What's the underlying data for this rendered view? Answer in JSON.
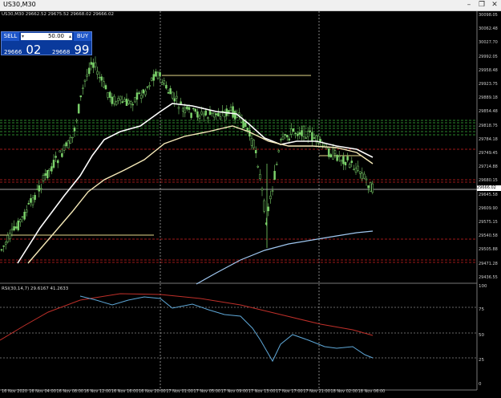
{
  "window": {
    "title": "US30,M30",
    "buttons": [
      "–",
      "❐",
      "✕"
    ]
  },
  "chart_info": {
    "ohlc": "US30,M30 29662.52 29675.52 29668.02 29666.02"
  },
  "trade_panel": {
    "sell_label": "SELL",
    "buy_label": "BUY",
    "lot_value": "50.00",
    "lot_down": "▾",
    "lot_up": "▴",
    "sell_price_prefix": "29666",
    "sell_price_big": "02",
    "buy_price_prefix": "29668",
    "buy_price_big": "99"
  },
  "indicator": {
    "label": "RSI(30,14,7) 29.6167 41.2633",
    "levels": [
      "100",
      "75",
      "50",
      "25",
      "0"
    ]
  },
  "price_axis": [
    "30098.05",
    "30062.48",
    "30027.70",
    "29992.05",
    "29958.48",
    "29923.75",
    "29889.18",
    "29854.48",
    "29818.75",
    "29784.18",
    "29749.45",
    "29714.88",
    "29680.15",
    "29645.58",
    "29609.90",
    "29575.15",
    "29540.58",
    "29505.88",
    "29471.28",
    "29436.55"
  ],
  "current_price_tag": "29666.02",
  "time_axis": [
    "16 Nov 2020",
    "16 Nov 04:00",
    "16 Nov 08:00",
    "16 Nov 12:00",
    "16 Nov 16:00",
    "16 Nov 20:00",
    "17 Nov 01:00",
    "17 Nov 05:00",
    "17 Nov 09:00",
    "17 Nov 13:00",
    "17 Nov 17:00",
    "17 Nov 21:00",
    "18 Nov 02:00",
    "18 Nov 06:00"
  ],
  "colors": {
    "background": "#000000",
    "bull_candle": "#7bd16a",
    "bear_candle": "#7bd16a",
    "ma_white": "#ffffff",
    "ma_cream": "#f5e9b8",
    "ma_blue": "#9fc7f0",
    "rsi_line": "#5fa8d8",
    "rsi_signal": "#c0302a",
    "level_red": "#d02020",
    "level_green": "#3cb43c",
    "level_yellow": "#e6d98a"
  }
}
